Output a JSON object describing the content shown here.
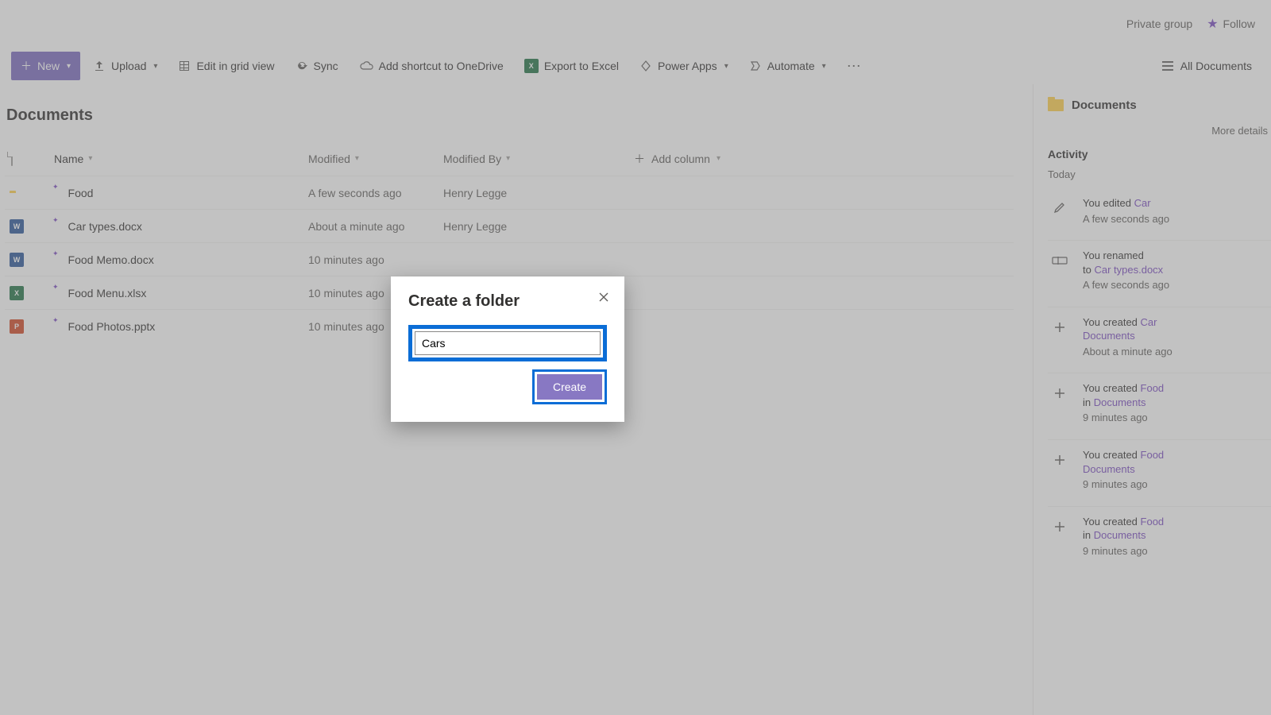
{
  "site": {
    "privacy": "Private group",
    "follow": "Follow"
  },
  "cmd": {
    "new": "New",
    "upload": "Upload",
    "editGrid": "Edit in grid view",
    "sync": "Sync",
    "shortcut": "Add shortcut to OneDrive",
    "export": "Export to Excel",
    "powerApps": "Power Apps",
    "automate": "Automate",
    "viewName": "All Documents"
  },
  "library": {
    "title": "Documents",
    "columns": {
      "name": "Name",
      "modified": "Modified",
      "modifiedBy": "Modified By",
      "add": "Add column"
    },
    "rows": [
      {
        "icon": "folder",
        "name": "Food",
        "modified": "A few seconds ago",
        "modifiedBy": "Henry Legge"
      },
      {
        "icon": "w",
        "name": "Car types.docx",
        "modified": "About a minute ago",
        "modifiedBy": "Henry Legge"
      },
      {
        "icon": "w",
        "name": "Food Memo.docx",
        "modified": "10 minutes ago",
        "modifiedBy": ""
      },
      {
        "icon": "x",
        "name": "Food Menu.xlsx",
        "modified": "10 minutes ago",
        "modifiedBy": ""
      },
      {
        "icon": "p",
        "name": "Food Photos.pptx",
        "modified": "10 minutes ago",
        "modifiedBy": ""
      }
    ]
  },
  "pane": {
    "header": "Documents",
    "moreDetails": "More details",
    "activity": "Activity",
    "today": "Today",
    "items": [
      {
        "icon": "edit",
        "line1_a": "You edited ",
        "line1_b": "Car",
        "line2": "",
        "ts": "A few seconds ago"
      },
      {
        "icon": "rename",
        "line1_a": "You renamed ",
        "line1_b": "",
        "line2_a": "to ",
        "line2_b": "Car types.docx",
        "ts": "A few seconds ago"
      },
      {
        "icon": "plus",
        "line1_a": "You created ",
        "line1_b": "Car",
        "line2_a": "",
        "line2_b": "Documents",
        "ts": "About a minute ago"
      },
      {
        "icon": "plus",
        "line1_a": "You created ",
        "line1_b": "Food",
        "line2_a": "in ",
        "line2_b": "Documents",
        "ts": "9 minutes ago"
      },
      {
        "icon": "plus",
        "line1_a": "You created ",
        "line1_b": "Food",
        "line2_a": "",
        "line2_b": "Documents",
        "ts": "9 minutes ago"
      },
      {
        "icon": "plus",
        "line1_a": "You created ",
        "line1_b": "Food",
        "line2_a": "in ",
        "line2_b": "Documents",
        "ts": "9 minutes ago"
      }
    ]
  },
  "dialog": {
    "title": "Create a folder",
    "value": "Cars",
    "create": "Create"
  }
}
